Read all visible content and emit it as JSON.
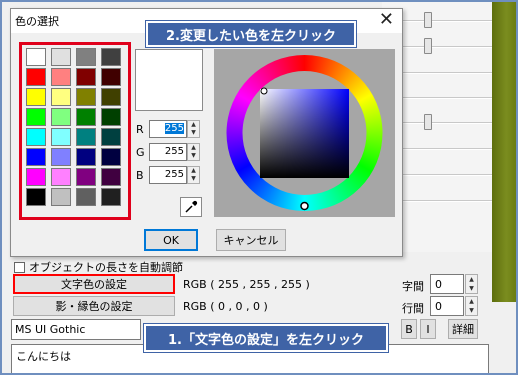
{
  "dialog": {
    "title": "色の選択",
    "close_glyph": "✕",
    "swatches": [
      "#ffffff",
      "#e0e0e0",
      "#808080",
      "#404040",
      "#ff0000",
      "#ff8080",
      "#800000",
      "#400000",
      "#ffff00",
      "#ffff80",
      "#808000",
      "#404000",
      "#00ff00",
      "#80ff80",
      "#008000",
      "#004000",
      "#00ffff",
      "#80ffff",
      "#008080",
      "#004040",
      "#0000ff",
      "#8080ff",
      "#000080",
      "#000040",
      "#ff00ff",
      "#ff80ff",
      "#800080",
      "#400040",
      "#000000",
      "#c0c0c0",
      "#606060",
      "#202020"
    ],
    "preview_color": "#ffffff",
    "channels": [
      {
        "label": "R",
        "value": "255"
      },
      {
        "label": "G",
        "value": "255"
      },
      {
        "label": "B",
        "value": "255"
      }
    ],
    "ok_label": "OK",
    "cancel_label": "キャンセル"
  },
  "settings": {
    "checkbox_label": "オブジェクトの長さを自動調節",
    "text_color_button": "文字色の設定",
    "text_rgb": "RGB ( 255 , 255 , 255 )",
    "shadow_color_button": "影・縁色の設定",
    "shadow_rgb": "RGB ( 0 , 0 , 0 )",
    "char_spacing_label": "字間",
    "char_spacing_value": "0",
    "line_spacing_label": "行間",
    "line_spacing_value": "0",
    "font_name": "MS UI Gothic",
    "bold_label": "B",
    "italic_label": "I",
    "detail_label": "詳細",
    "text_content": "こんにちは"
  },
  "callouts": {
    "step2": "2.変更したい色を左クリック",
    "step1": "1.「文字色の設定」を左クリック"
  },
  "colors": {
    "highlight": "#ff0000",
    "callout_bg": "#3f63a6",
    "selection": "#0078d7"
  }
}
